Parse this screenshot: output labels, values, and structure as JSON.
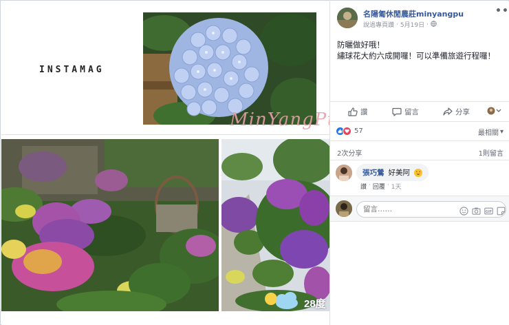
{
  "collage": {
    "brand_text": "INSTAMAG",
    "watermark": "MinYangPu",
    "weather_temp": "28度"
  },
  "post": {
    "page_name": "名陽匍休閒農莊minyangpu",
    "meta_prefix": "說過專頁讚",
    "date": "5月19日",
    "text_line1": "防曬做好哦！",
    "text_line2": "繡球花大約六成開囉！可以準備旅遊行程囉！"
  },
  "actions": {
    "like": "讚",
    "comment": "留言",
    "share": "分享"
  },
  "reactions": {
    "count": "57",
    "sort_label": "最相關"
  },
  "engagement": {
    "shares": "2次分享",
    "replies": "1則留言"
  },
  "comment": {
    "author": "張巧鶯",
    "text": "好美阿",
    "like_label": "讚",
    "reply_label": "回覆",
    "time": "1天"
  },
  "composer": {
    "placeholder": "留言……"
  },
  "colors": {
    "link_blue": "#365899",
    "like_blue": "#1877f2",
    "love_red": "#f33e58",
    "meta_gray": "#90949c"
  },
  "icons": [
    "more-icon",
    "globe-icon",
    "like-icon",
    "comment-icon",
    "share-icon",
    "reaction-selector-icon",
    "emoji-icon",
    "camera-icon",
    "gif-icon",
    "sticker-icon",
    "sun-icon",
    "cloud-icon"
  ]
}
